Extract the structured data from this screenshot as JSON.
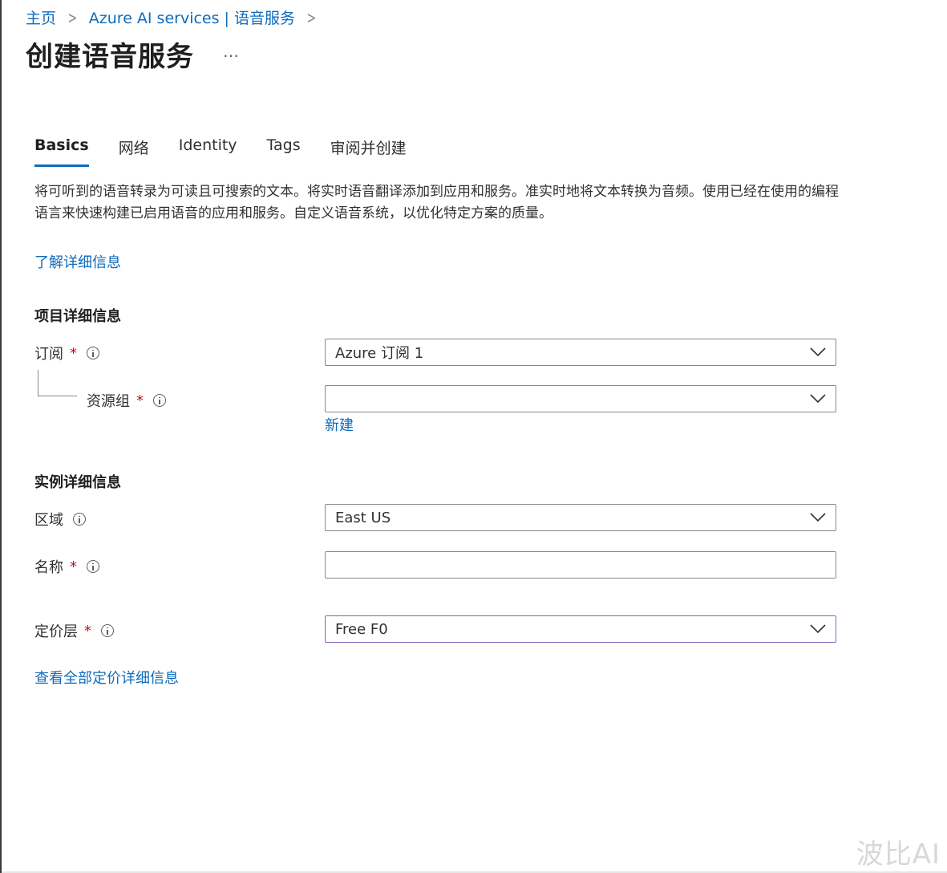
{
  "breadcrumb": {
    "home": "主页",
    "service": "Azure AI services | 语音服务"
  },
  "page": {
    "title": "创建语音服务",
    "more": "…"
  },
  "tabs": [
    {
      "label": "Basics",
      "active": true
    },
    {
      "label": "网络",
      "active": false
    },
    {
      "label": "Identity",
      "active": false
    },
    {
      "label": "Tags",
      "active": false
    },
    {
      "label": "审阅并创建",
      "active": false
    }
  ],
  "description": "将可听到的语音转录为可读且可搜索的文本。将实时语音翻译添加到应用和服务。准实时地将文本转换为音频。使用已经在使用的编程语言来快速构建已启用语音的应用和服务。自定义语音系统，以优化特定方案的质量。",
  "learn_more": "了解详细信息",
  "project_details": {
    "title": "项目详细信息",
    "subscription": {
      "label": "订阅",
      "required": "*",
      "value": "Azure 订阅 1"
    },
    "resource_group": {
      "label": "资源组",
      "required": "*",
      "value": "",
      "create_new": "新建"
    }
  },
  "instance_details": {
    "title": "实例详细信息",
    "region": {
      "label": "区域",
      "value": "East US"
    },
    "name": {
      "label": "名称",
      "required": "*",
      "value": ""
    },
    "pricing_tier": {
      "label": "定价层",
      "required": "*",
      "value": "Free F0"
    }
  },
  "pricing_link": "查看全部定价详细信息",
  "watermark": "波比AI",
  "colors": {
    "link": "#0f6cbd",
    "required": "#c50f1f",
    "focus_border": "#8764b8",
    "border": "#8a8886"
  },
  "icons": {
    "info": "info-circle-icon",
    "chevron": "chevron-down-icon",
    "more": "more-ellipsis-icon"
  }
}
